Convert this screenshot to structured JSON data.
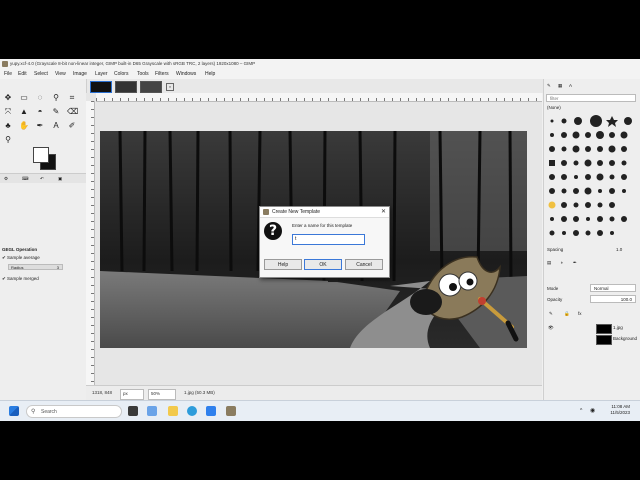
{
  "window": {
    "title": "yupy.xcf-4.0 (Grayscale 8-bit non-linear integer, GIMP built-in D65 Grayscale with sRGB TRC, 2 layers) 1920x1080 – GIMP"
  },
  "menu": [
    "File",
    "Edit",
    "Select",
    "View",
    "Image",
    "Layer",
    "Colors",
    "Tools",
    "Filters",
    "Windows",
    "Help"
  ],
  "tool_options": {
    "header": "GEGL Operation",
    "sample_average": "Sample average",
    "radius_label": "Radius",
    "radius_value": "3",
    "sample_merged": "Sample merged"
  },
  "right_panel": {
    "filter_placeholder": "filter",
    "brush_name": "(None)",
    "spacing_label": "Spacing",
    "spacing_value": "1.0",
    "mode_label": "Mode",
    "mode_value": "Normal",
    "opacity_label": "Opacity",
    "opacity_value": "100.0",
    "layers": [
      {
        "name": "1.jpg"
      },
      {
        "name": "Background"
      }
    ]
  },
  "dialog": {
    "title": "Create New Template",
    "label": "Enter a name for this template",
    "input_value": "t",
    "buttons": {
      "help": "Help",
      "ok": "OK",
      "cancel": "Cancel"
    }
  },
  "status": {
    "coords": "1318, 848",
    "unit": "px",
    "zoom": "50%",
    "info": "1.jpg (50.3 MB)"
  },
  "taskbar": {
    "search_placeholder": "Search",
    "time": "11:08 AM",
    "date": "11/5/2023"
  },
  "colors": {
    "accent": "#3b78d8",
    "taskbar": "#e8eef5"
  }
}
